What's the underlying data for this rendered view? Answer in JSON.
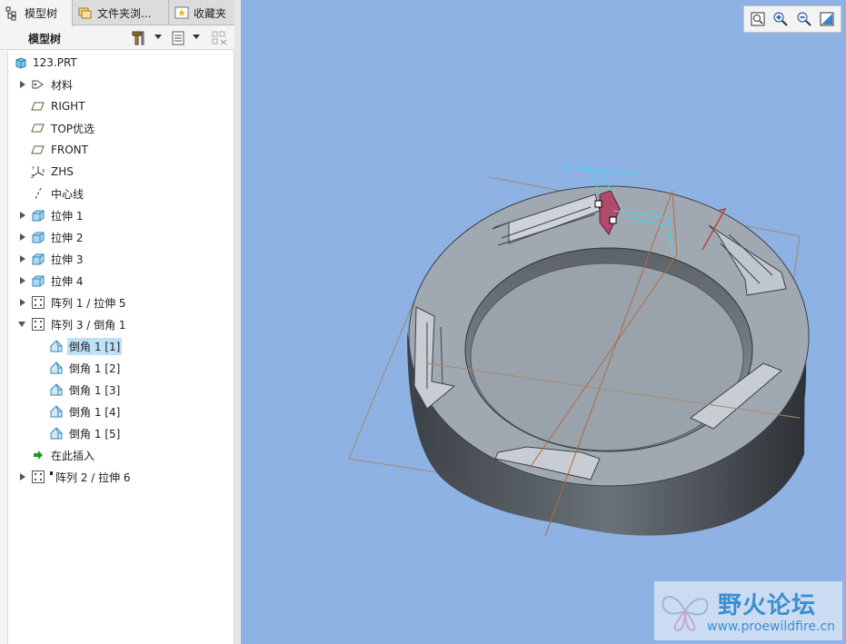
{
  "tabs": [
    {
      "label": "模型树",
      "icon": "model-tree-icon"
    },
    {
      "label": "文件夹浏...",
      "icon": "folder-browser-icon"
    },
    {
      "label": "收藏夹",
      "icon": "favorites-icon"
    }
  ],
  "toolbar": {
    "title": "模型树"
  },
  "tree": {
    "items": [
      {
        "label": "123.PRT",
        "icon": "part-icon",
        "expander": "none"
      },
      {
        "label": "材料",
        "icon": "material-icon",
        "expander": "collapsed"
      },
      {
        "label": "RIGHT",
        "icon": "datum-plane-icon",
        "expander": "none"
      },
      {
        "label": "TOP优选",
        "icon": "datum-plane-icon",
        "expander": "none"
      },
      {
        "label": "FRONT",
        "icon": "datum-plane-icon",
        "expander": "none"
      },
      {
        "label": "ZHS",
        "icon": "coordinate-system-icon",
        "expander": "none"
      },
      {
        "label": "中心线",
        "icon": "datum-axis-icon",
        "expander": "none"
      },
      {
        "label": "拉伸 1",
        "icon": "extrude-icon",
        "expander": "collapsed"
      },
      {
        "label": "拉伸 2",
        "icon": "extrude-icon",
        "expander": "collapsed"
      },
      {
        "label": "拉伸 3",
        "icon": "extrude-icon",
        "expander": "collapsed"
      },
      {
        "label": "拉伸 4",
        "icon": "extrude-icon",
        "expander": "collapsed"
      },
      {
        "label": "阵列 1 / 拉伸 5",
        "icon": "pattern-icon",
        "expander": "collapsed"
      },
      {
        "label": "阵列 3 / 倒角 1",
        "icon": "pattern-icon",
        "expander": "expanded"
      },
      {
        "label": "倒角 1 [1]",
        "icon": "chamfer-icon",
        "expander": "none",
        "selected": true
      },
      {
        "label": "倒角 1 [2]",
        "icon": "chamfer-icon",
        "expander": "none"
      },
      {
        "label": "倒角 1 [3]",
        "icon": "chamfer-icon",
        "expander": "none"
      },
      {
        "label": "倒角 1 [4]",
        "icon": "chamfer-icon",
        "expander": "none"
      },
      {
        "label": "倒角 1 [5]",
        "icon": "chamfer-icon",
        "expander": "none"
      },
      {
        "label": "在此插入",
        "icon": "insert-here-icon",
        "expander": "none"
      },
      {
        "label": "阵列 2 / 拉伸 6",
        "icon": "pattern-icon",
        "expander": "collapsed"
      }
    ]
  },
  "view_toolbar": [
    {
      "icon": "zoom-fit-icon"
    },
    {
      "icon": "zoom-in-icon"
    },
    {
      "icon": "zoom-out-icon"
    },
    {
      "icon": "repaint-icon"
    }
  ],
  "watermark": {
    "title": "野火论坛",
    "url": "www.proewildfire.cn"
  },
  "colors": {
    "viewport": "#8db2e3",
    "selection": "#bfe1f7",
    "part": "#9aa4ad",
    "datum": "#a86a4c"
  }
}
